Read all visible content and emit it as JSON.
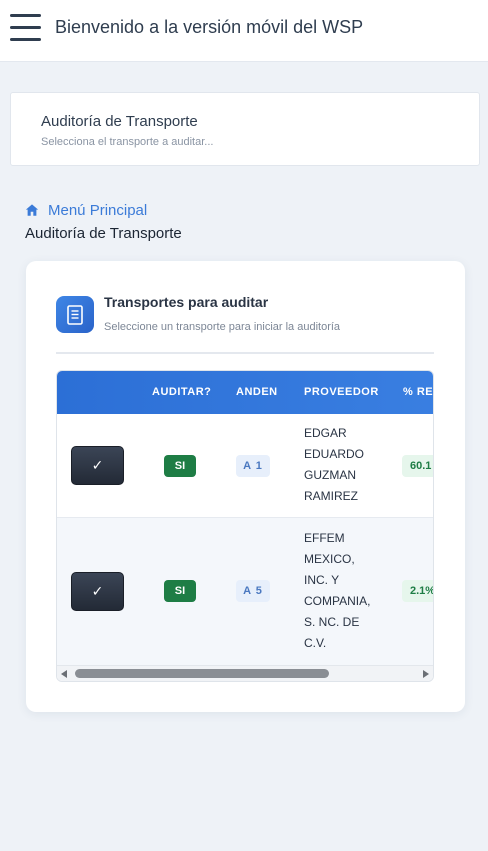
{
  "app": {
    "title": "Bienvenido a la versión móvil del WSP"
  },
  "page_header": {
    "title": "Auditoría de Transporte",
    "subtitle": "Selecciona el transporte a auditar..."
  },
  "breadcrumb": {
    "home_label": "Menú Principal",
    "current": "Auditoría de Transporte"
  },
  "card": {
    "title": "Transportes para auditar",
    "subtitle": "Seleccione un transporte para iniciar la auditoría"
  },
  "table": {
    "columns": [
      "",
      "AUDITAR?",
      "ANDEN",
      "PROVEEDOR",
      "% RE"
    ],
    "rows": [
      {
        "action": "✓",
        "auditar": "SI",
        "anden": "A 1",
        "proveedor_lines": [
          "EDGAR",
          "EDUARDO",
          "GUZMAN",
          "RAMIREZ"
        ],
        "pct": "60.1"
      },
      {
        "action": "✓",
        "auditar": "SI",
        "anden": "A 5",
        "proveedor_lines": [
          "EFFEM",
          "MEXICO,",
          "INC. Y",
          "COMPANIA,",
          "S. NC. DE",
          "C.V."
        ],
        "pct": "2.1%"
      }
    ]
  },
  "colors": {
    "accent": "#2c6fd6",
    "success": "#1e7d45",
    "link": "#3b7bd8"
  },
  "icons": {
    "menu": "hamburger-icon",
    "home": "home-icon",
    "card": "document-icon",
    "check": "check-icon"
  }
}
